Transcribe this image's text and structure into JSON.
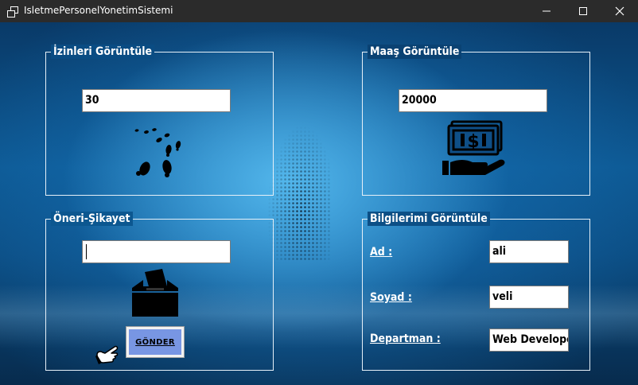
{
  "window": {
    "title": "IsletmePersonelYonetimSistemi"
  },
  "groups": {
    "leave": {
      "title": "İzinleri Görüntüle",
      "value": "30",
      "icon": "footprints-icon"
    },
    "salary": {
      "title": "Maaş Görüntüle",
      "value": "20000",
      "icon": "money-hand-icon"
    },
    "suggestion": {
      "title": "Öneri-Şikayet",
      "value": "",
      "icon": "ballot-box-icon",
      "send_label": "GÖNDER",
      "pointer_icon": "hand-pointer-icon"
    },
    "profile": {
      "title": "Bilgilerimi Görüntüle",
      "fields": [
        {
          "label": "Ad :",
          "value": "ali"
        },
        {
          "label": "Soyad :",
          "value": "veli"
        },
        {
          "label": "Departman :",
          "value": "Web Developer"
        }
      ]
    }
  },
  "colors": {
    "titlebar": "#2b2b2b",
    "background_dark": "#072b4d",
    "background_glow": "#56baee",
    "button_fill": "#7896e3"
  }
}
